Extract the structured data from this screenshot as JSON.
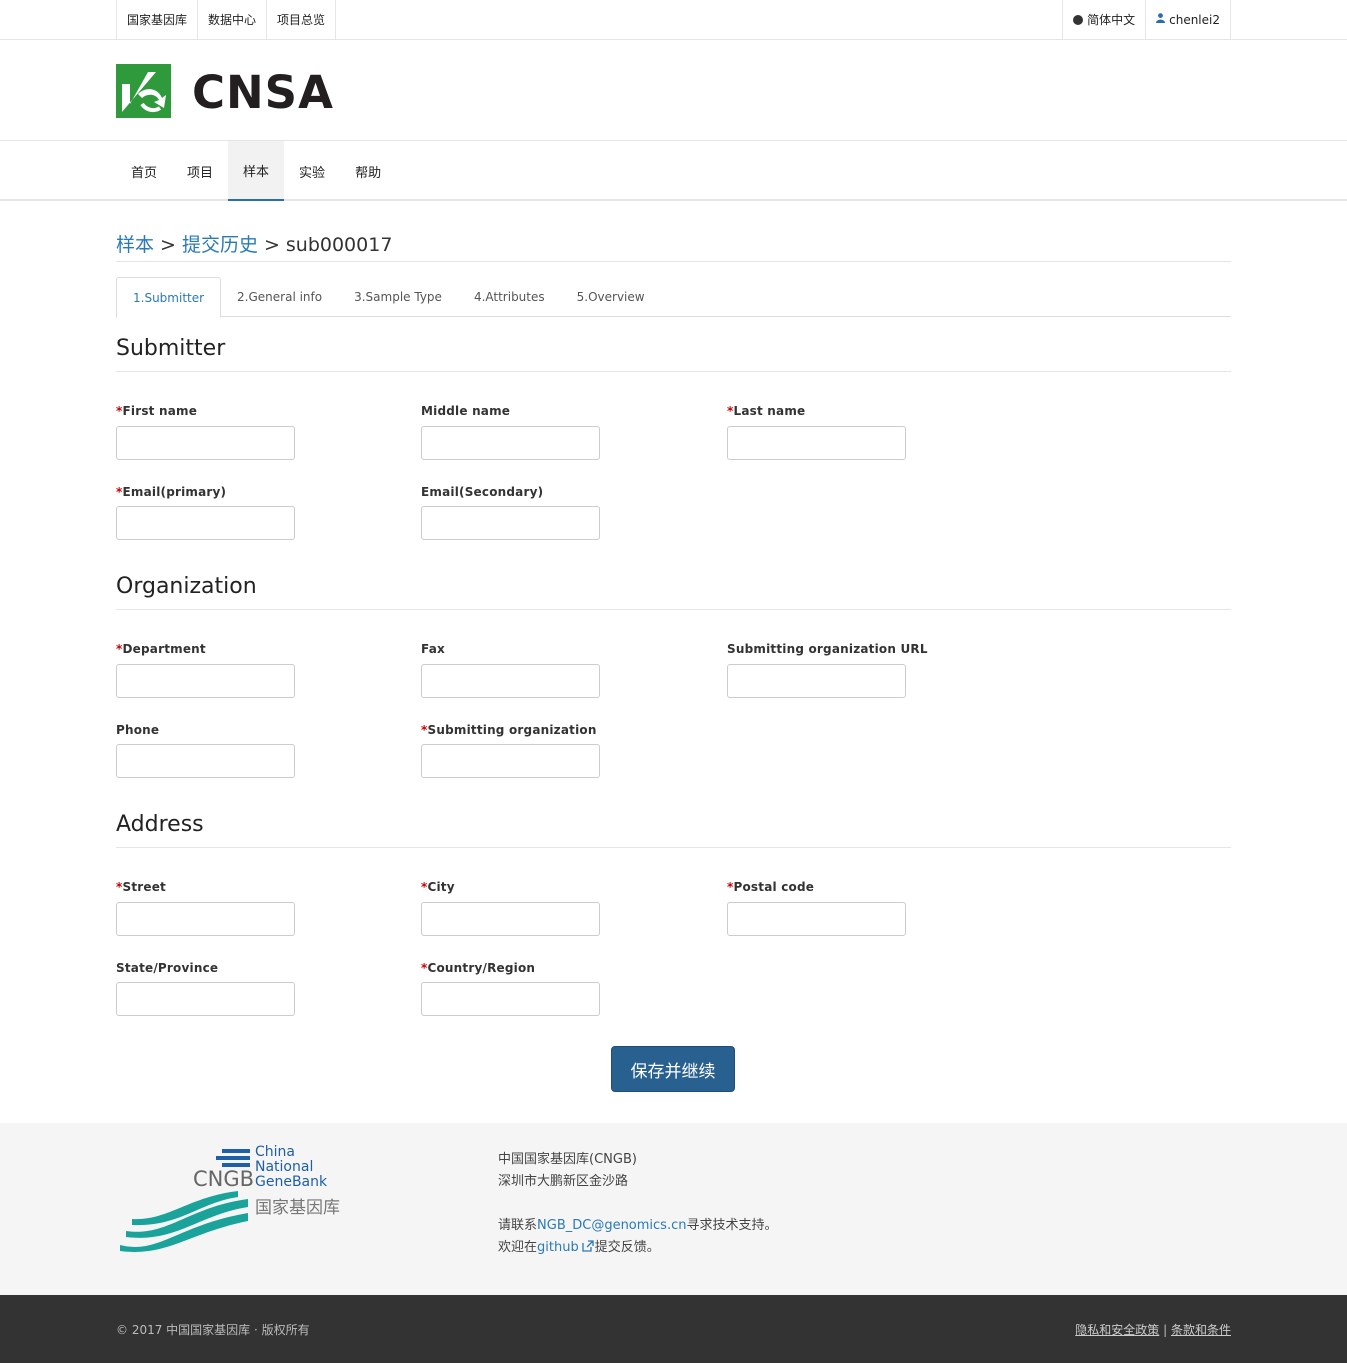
{
  "topbar": {
    "left": [
      "国家基因库",
      "数据中心",
      "项目总览"
    ],
    "language": "简体中文",
    "user": "chenlei2"
  },
  "brand": {
    "name": "CNSA",
    "color": "#2e9a3b"
  },
  "nav": [
    "首页",
    "项目",
    "样本",
    "实验",
    "帮助"
  ],
  "breadcrumb": {
    "item1": "样本",
    "item2": "提交历史",
    "sep": ">",
    "current": "sub000017"
  },
  "tabs": [
    "1.Submitter",
    "2.General info",
    "3.Sample Type",
    "4.Attributes",
    "5.Overview"
  ],
  "sections": {
    "submitter": {
      "title": "Submitter",
      "first_name": "First name",
      "middle_name": "Middle name",
      "last_name": "Last name",
      "email_primary": "Email(primary)",
      "email_secondary": "Email(Secondary)"
    },
    "organization": {
      "title": "Organization",
      "department": "Department",
      "fax": "Fax",
      "url": "Submitting organization URL",
      "phone": "Phone",
      "org": "Submitting organization"
    },
    "address": {
      "title": "Address",
      "street": "Street",
      "city": "City",
      "postal": "Postal code",
      "state": "State/Province",
      "country": "Country/Region"
    }
  },
  "required_mark": "*",
  "save_button": "保存并继续",
  "footer": {
    "logo_lines": [
      "China",
      "National",
      "GeneBank"
    ],
    "logo_abbr": "CNGB",
    "logo_cn": "国家基因库",
    "org_name": "中国国家基因库(CNGB)",
    "address": "深圳市大鹏新区金沙路",
    "contact_prefix": "请联系",
    "contact_email": "NGB_DC@genomics.cn",
    "contact_suffix": "寻求技术支持。",
    "feedback_prefix": "欢迎在",
    "feedback_link": "github",
    "feedback_suffix": "提交反馈。",
    "copyright": "© 2017 中国国家基因库 · 版权所有",
    "privacy": "隐私和安全政策",
    "divider": "|",
    "terms": "条款和条件"
  }
}
